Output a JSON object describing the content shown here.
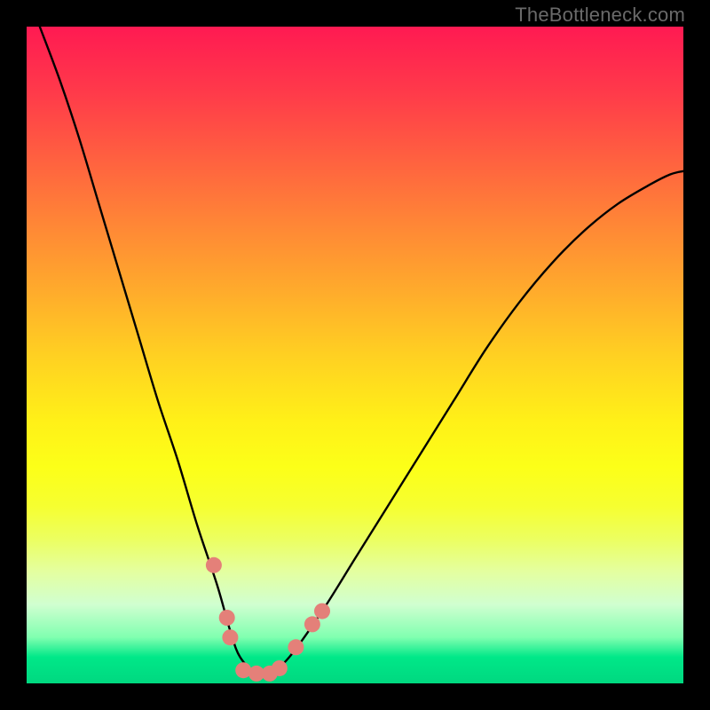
{
  "watermark": "TheBottleneck.com",
  "chart_data": {
    "type": "line",
    "title": "",
    "xlabel": "",
    "ylabel": "",
    "xlim": [
      0,
      100
    ],
    "ylim": [
      0,
      100
    ],
    "series": [
      {
        "name": "bottleneck-curve",
        "x": [
          2,
          5,
          8,
          11,
          14,
          17,
          20,
          23,
          26,
          29,
          31,
          32.5,
          35,
          37,
          40,
          45,
          50,
          55,
          60,
          65,
          70,
          75,
          80,
          85,
          90,
          95,
          98,
          100
        ],
        "values": [
          100,
          92,
          83,
          73,
          63,
          53,
          43,
          34,
          24,
          15,
          8,
          4,
          1.5,
          1.5,
          4,
          11,
          19,
          27,
          35,
          43,
          51,
          58,
          64,
          69,
          73,
          76,
          77.5,
          78
        ]
      }
    ],
    "markers": [
      {
        "name": "left-upper-dot",
        "x": 28.5,
        "y": 18
      },
      {
        "name": "left-mid-dot",
        "x": 30.5,
        "y": 10
      },
      {
        "name": "left-low-dot",
        "x": 31.0,
        "y": 7
      },
      {
        "name": "bottom-pill-1",
        "x": 33.0,
        "y": 2
      },
      {
        "name": "bottom-pill-2",
        "x": 35.0,
        "y": 1.5
      },
      {
        "name": "bottom-pill-3",
        "x": 37.0,
        "y": 1.5
      },
      {
        "name": "bottom-pill-4",
        "x": 38.5,
        "y": 2.3
      },
      {
        "name": "right-low-dot",
        "x": 41.0,
        "y": 5.5
      },
      {
        "name": "right-mid-dot",
        "x": 43.5,
        "y": 9.0
      },
      {
        "name": "right-upper-dot",
        "x": 45.0,
        "y": 11.0
      }
    ],
    "colors": {
      "curve": "#000000",
      "markers": "#e48079",
      "gradient_top": "#ff1a52",
      "gradient_mid": "#fff018",
      "gradient_bottom": "#00d880"
    }
  }
}
